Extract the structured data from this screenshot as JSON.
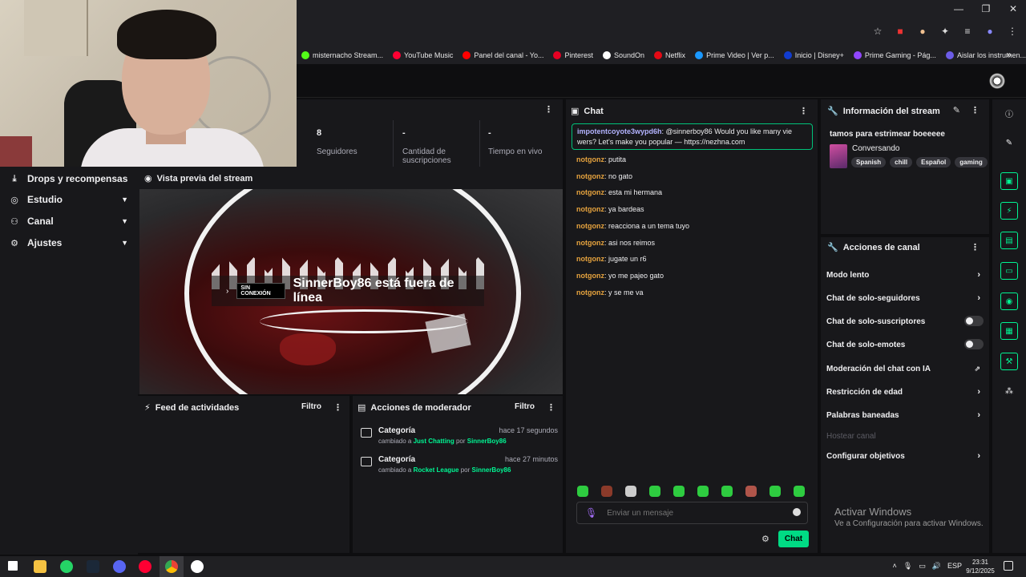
{
  "bookmarks": [
    {
      "label": "misternacho Stream...",
      "color": "#53fc18"
    },
    {
      "label": "YouTube Music",
      "color": "#ff0033"
    },
    {
      "label": "Panel del canal - Yo...",
      "color": "#ff0000"
    },
    {
      "label": "Pinterest",
      "color": "#e60023"
    },
    {
      "label": "SoundOn",
      "color": "#ffffff"
    },
    {
      "label": "Netflix",
      "color": "#e50914"
    },
    {
      "label": "Prime Video | Ver p...",
      "color": "#1a98ff"
    },
    {
      "label": "Inicio | Disney+",
      "color": "#113ccf"
    },
    {
      "label": "Prime Gaming - Pág...",
      "color": "#9146ff"
    },
    {
      "label": "Aislar los instrumen...",
      "color": "#6c5ce7"
    }
  ],
  "nav": {
    "drops": "Drops y recompensas",
    "estudio": "Estudio",
    "canal": "Canal",
    "ajustes": "Ajustes"
  },
  "stats": {
    "followers_value": "8",
    "followers_label": "Seguidores",
    "subs_value": "-",
    "subs_label": "Cantidad de suscripciones",
    "live_value": "-",
    "live_label": "Tiempo en vivo"
  },
  "preview": {
    "title": "Vista previa del stream",
    "offline_badge": "SIN CONEXIÓN",
    "offline_text": "SinnerBoy86 está fuera de línea"
  },
  "feed": {
    "title": "Feed de actividades",
    "filter": "Filtro"
  },
  "mod": {
    "title": "Acciones de moderador",
    "filter": "Filtro",
    "entries": [
      {
        "title": "Categoría",
        "time": "hace 17 segundos",
        "prefix": "cambiado a",
        "category": "Just Chatting",
        "by": "por",
        "user": "SinnerBoy86"
      },
      {
        "title": "Categoría",
        "time": "hace 27 minutos",
        "prefix": "cambiado a",
        "category": "Rocket League",
        "by": "por",
        "user": "SinnerBoy86"
      }
    ]
  },
  "chat": {
    "title": "Chat",
    "pinned_user": "impotentcoyote3wypd6h",
    "pinned_text": ": @sinnerboy86 Would you like many vie",
    "pinned_text2": "wers? Let's make you popular — https://nezhna.com",
    "messages": [
      {
        "user": "notgonz",
        "text": ": putita"
      },
      {
        "user": "notgonz",
        "text": ": no gato"
      },
      {
        "user": "notgonz",
        "text": ": esta mi hermana"
      },
      {
        "user": "notgonz",
        "text": ": ya bardeas"
      },
      {
        "user": "notgonz",
        "text": ": reacciona a un tema tuyo"
      },
      {
        "user": "notgonz",
        "text": ": asi nos reimos"
      },
      {
        "user": "notgonz",
        "text": ": jugate un r6"
      },
      {
        "user": "notgonz",
        "text": ": yo me pajeo gato"
      },
      {
        "user": "notgonz",
        "text": ": y se me va"
      }
    ],
    "input_placeholder": "Enviar un mensaje",
    "send_label": "Chat"
  },
  "info": {
    "title": "Información del stream",
    "stream_title": "tamos para estrimear boeeeee",
    "category": "Conversando",
    "tags": [
      "Spanish",
      "chill",
      "Español",
      "gaming"
    ]
  },
  "actions": {
    "title": "Acciones de canal",
    "modo_lento": "Modo lento",
    "solo_seguidores": "Chat de solo-seguidores",
    "solo_suscriptores": "Chat de solo-suscriptores",
    "solo_emotes": "Chat de solo-emotes",
    "moderacion_ia": "Moderación del chat con IA",
    "restriccion_edad": "Restricción de edad",
    "palabras_baneadas": "Palabras baneadas",
    "hostear": "Hostear canal",
    "objetivos": "Configurar objetivos"
  },
  "windows": {
    "activate_title": "Activar Windows",
    "activate_sub": "Ve a Configuración para activar Windows."
  },
  "taskbar": {
    "lang": "ESP",
    "time": "23:31",
    "date": "9/12/2025"
  }
}
